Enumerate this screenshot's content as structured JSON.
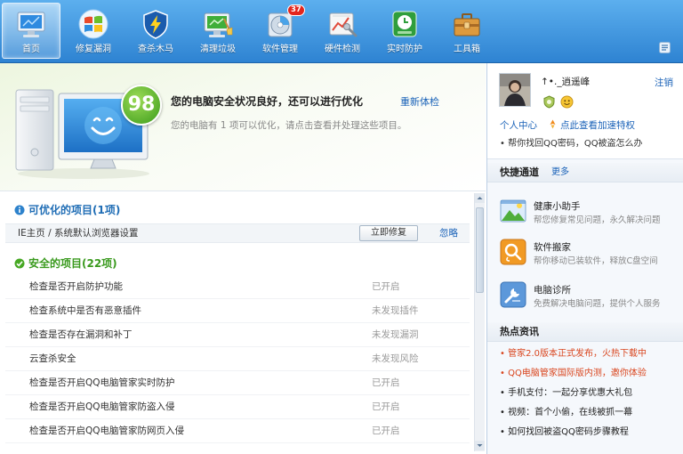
{
  "toolbar": {
    "items": [
      {
        "label": "首页",
        "icon": "monitor-home-icon",
        "selected": true
      },
      {
        "label": "修复漏洞",
        "icon": "windows-logo-icon"
      },
      {
        "label": "查杀木马",
        "icon": "shield-lightning-icon"
      },
      {
        "label": "清理垃圾",
        "icon": "monitor-broom-icon"
      },
      {
        "label": "软件管理",
        "icon": "software-disc-icon",
        "badge": "37"
      },
      {
        "label": "硬件检测",
        "icon": "hardware-chart-icon"
      },
      {
        "label": "实时防护",
        "icon": "shield-clock-icon"
      },
      {
        "label": "工具箱",
        "icon": "toolbox-icon"
      }
    ],
    "corner_icon": "settings-menu-icon",
    "bg_top": "#5cafee",
    "bg_bottom": "#2e83d2"
  },
  "status": {
    "score": "98",
    "score_color": "#3b9b1b",
    "headline": "您的电脑安全状况良好，还可以进行优化",
    "recheck_link": "重新体检",
    "detail": "您的电脑有 1 项可以优化，请点击查看并处理这些项目。"
  },
  "optimizable": {
    "title": "可优化的项目(1项)",
    "color": "#1f6db5",
    "items": [
      {
        "label": "IE主页 / 系统默认浏览器设置",
        "action": "立即修复",
        "ignore": "忽略"
      }
    ]
  },
  "safe": {
    "title": "安全的项目(22项)",
    "color": "#3a9a1e",
    "items": [
      {
        "label": "检查是否开启防护功能",
        "status": "已开启"
      },
      {
        "label": "检查系统中是否有恶意插件",
        "status": "未发现插件"
      },
      {
        "label": "检查是否存在漏洞和补丁",
        "status": "未发现漏洞"
      },
      {
        "label": "云查杀安全",
        "status": "未发现风险"
      },
      {
        "label": "检查是否开启QQ电脑管家实时防护",
        "status": "已开启"
      },
      {
        "label": "检查是否开启QQ电脑管家防盗入侵",
        "status": "已开启"
      },
      {
        "label": "检查是否开启QQ电脑管家防网页入侵",
        "status": "已开启"
      }
    ]
  },
  "account": {
    "name": "↑•._逍遥峰",
    "logout": "注销",
    "center_link": "个人中心",
    "boost_link": "点此查看加速特权",
    "tip": "• 帮你找回QQ密码，QQ被盗怎么办"
  },
  "quick": {
    "title": "快捷通道",
    "more": "更多",
    "items": [
      {
        "title": "健康小助手",
        "desc": "帮您修复常见问题，永久解决问题",
        "icon": "landscape-icon"
      },
      {
        "title": "软件搬家",
        "desc": "帮你移动已装软件，释放C盘空间",
        "icon": "software-move-icon"
      },
      {
        "title": "电脑诊所",
        "desc": "免费解决电脑问题，提供个人服务",
        "icon": "clinic-wrench-icon"
      }
    ]
  },
  "news": {
    "title": "热点资讯",
    "hot_color": "#d9461f",
    "items": [
      {
        "text": "• 管家2.0版本正式发布，火热下载中",
        "hot": true
      },
      {
        "text": "• QQ电脑管家国际版内测，邀你体验",
        "hot": true
      },
      {
        "text": "• 手机支付：一起分享优惠大礼包",
        "hot": false
      },
      {
        "text": "• 视频：首个小偷，在线被抓一幕",
        "hot": false
      },
      {
        "text": "• 如何找回被盗QQ密码步骤教程",
        "hot": false
      }
    ]
  }
}
